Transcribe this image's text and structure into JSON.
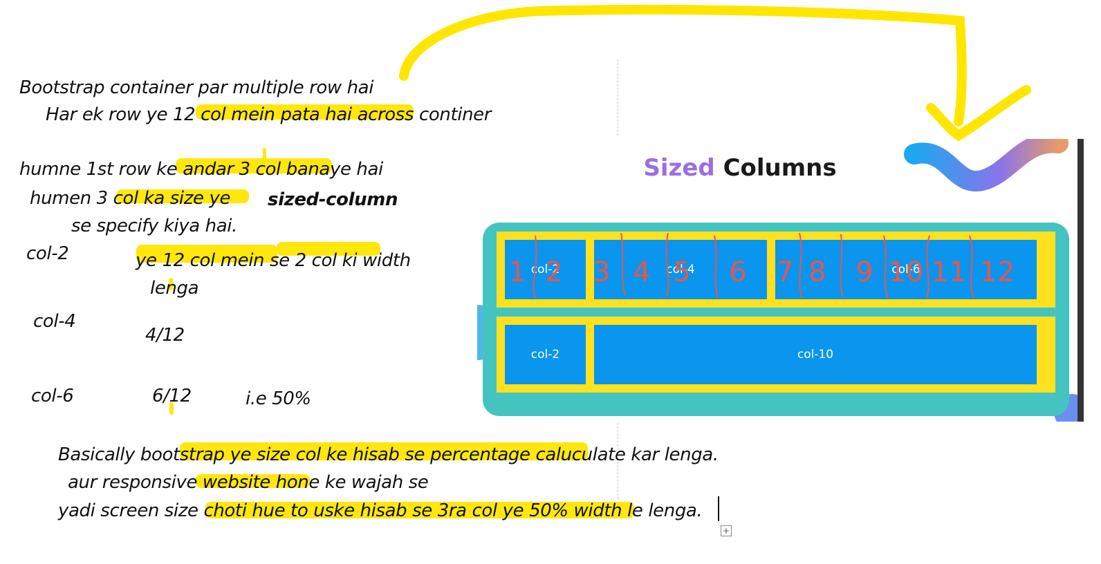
{
  "notes": {
    "line1": "Bootstrap container par multiple row hai",
    "line2": "Har ek row ye 12 col mein pata hai across continer",
    "line3": "humne 1st row ke andar 3 col banaye hai",
    "line4": "humen 3 col ka size ye",
    "line4_bold": "sized-column",
    "line5": "se specify kiya hai.",
    "col2_label": "col-2",
    "col2_desc_a": "ye 12 col mein se 2 col ki width",
    "col2_desc_b": "lenga",
    "col4_label": "col-4",
    "col4_ratio": "4/12",
    "col6_label": "col-6",
    "col6_ratio": "6/12",
    "col6_pct": "i.e 50%",
    "para1": "Basically bootstrap ye size col ke hisab se percentage caluculate kar lenga.",
    "para2": "aur responsive website hone ke wajah se",
    "para3": "yadi screen size choti hue to uske hisab se 3ra col ye 50% width le lenga."
  },
  "slide": {
    "title_accent": "Sized",
    "title_rest": "Columns",
    "accent_color": "#9b6fe0",
    "title_color": "#1a1a1a",
    "container_color": "#44c4c1",
    "row_color": "#ffe11f",
    "col_color": "#0a95ee",
    "row1": [
      "col-2",
      "col-4",
      "col-6"
    ],
    "row2": [
      "col-2",
      "col-10"
    ],
    "handwritten_numbers": [
      "1",
      "2",
      "3",
      "4",
      "5",
      "6",
      "7",
      "8",
      "9",
      "10",
      "11",
      "12"
    ]
  },
  "annotation": {
    "highlight_color": "#ffe600",
    "pen_color": "#e5574d"
  }
}
